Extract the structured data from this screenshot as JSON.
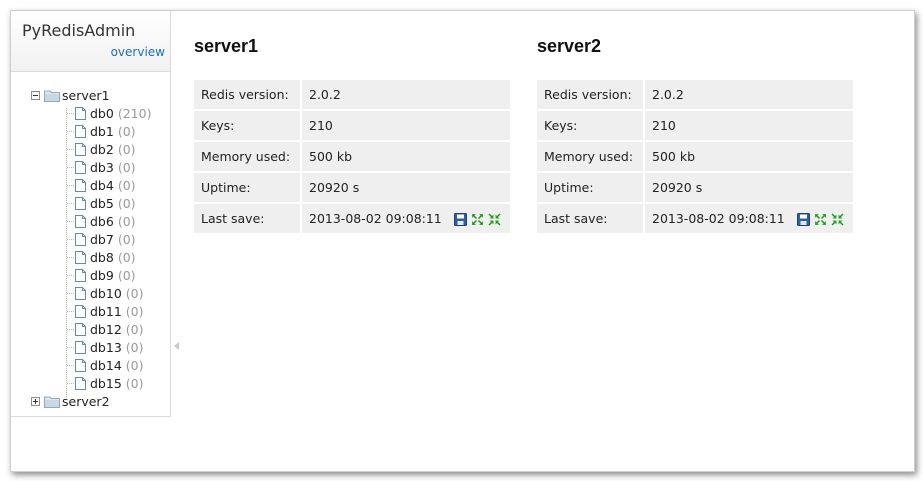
{
  "app": {
    "title": "PyRedisAdmin",
    "overview_link": "overview"
  },
  "tree": {
    "servers": [
      {
        "name": "server1",
        "expanded": true,
        "databases": [
          {
            "name": "db0",
            "count": "(210)"
          },
          {
            "name": "db1",
            "count": "(0)"
          },
          {
            "name": "db2",
            "count": "(0)"
          },
          {
            "name": "db3",
            "count": "(0)"
          },
          {
            "name": "db4",
            "count": "(0)"
          },
          {
            "name": "db5",
            "count": "(0)"
          },
          {
            "name": "db6",
            "count": "(0)"
          },
          {
            "name": "db7",
            "count": "(0)"
          },
          {
            "name": "db8",
            "count": "(0)"
          },
          {
            "name": "db9",
            "count": "(0)"
          },
          {
            "name": "db10",
            "count": "(0)"
          },
          {
            "name": "db11",
            "count": "(0)"
          },
          {
            "name": "db12",
            "count": "(0)"
          },
          {
            "name": "db13",
            "count": "(0)"
          },
          {
            "name": "db14",
            "count": "(0)"
          },
          {
            "name": "db15",
            "count": "(0)"
          }
        ]
      },
      {
        "name": "server2",
        "expanded": false,
        "databases": []
      }
    ]
  },
  "panels": [
    {
      "title": "server1",
      "rows": [
        {
          "label": "Redis version:",
          "value": "2.0.2"
        },
        {
          "label": "Keys:",
          "value": "210"
        },
        {
          "label": "Memory used:",
          "value": "500 kb"
        },
        {
          "label": "Uptime:",
          "value": "20920 s"
        },
        {
          "label": "Last save:",
          "value": "2013-08-02 09:08:11"
        }
      ],
      "actions": [
        "save-icon",
        "expand-icon",
        "collapse-icon"
      ]
    },
    {
      "title": "server2",
      "rows": [
        {
          "label": "Redis version:",
          "value": "2.0.2"
        },
        {
          "label": "Keys:",
          "value": "210"
        },
        {
          "label": "Memory used:",
          "value": "500 kb"
        },
        {
          "label": "Uptime:",
          "value": "20920 s"
        },
        {
          "label": "Last save:",
          "value": "2013-08-02 09:08:11"
        }
      ],
      "actions": [
        "save-icon",
        "expand-icon",
        "collapse-icon"
      ]
    }
  ],
  "colors": {
    "link": "#1a6fbf",
    "count": "#9a9a9a",
    "row_bg": "#efefef",
    "icon_green": "#3aa83a",
    "icon_blue": "#2f5f9e"
  }
}
